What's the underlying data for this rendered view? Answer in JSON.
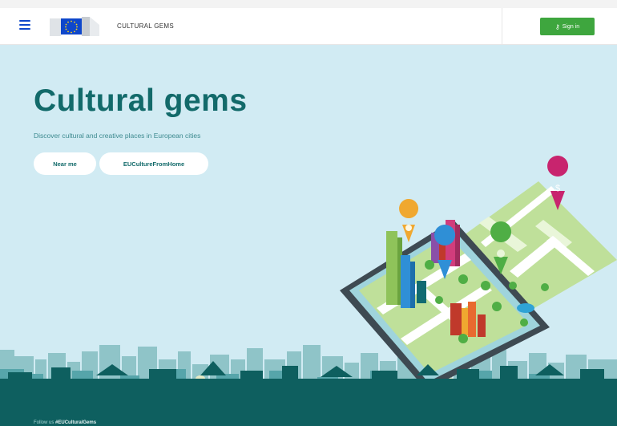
{
  "header": {
    "site_title": "CULTURAL GEMS",
    "signin_label": "Sign in",
    "menu_icon": "hamburger-menu-icon",
    "logo_icon": "european-commission-logo",
    "signin_icon": "key-icon"
  },
  "hero": {
    "title": "Cultural gems",
    "subtitle": "Discover cultural and creative places in European cities",
    "buttons": [
      {
        "label": "Near me"
      },
      {
        "label": "EUCultureFromHome"
      }
    ]
  },
  "footer": {
    "prefix": "Follow us",
    "hashtag": "#EUCulturalGems"
  },
  "colors": {
    "accent": "#126a6a",
    "signin": "#3ea63e",
    "hero_bg": "#d1ebf3",
    "skyline_dark": "#0e5f5f",
    "eu_blue": "#0e47cb"
  }
}
